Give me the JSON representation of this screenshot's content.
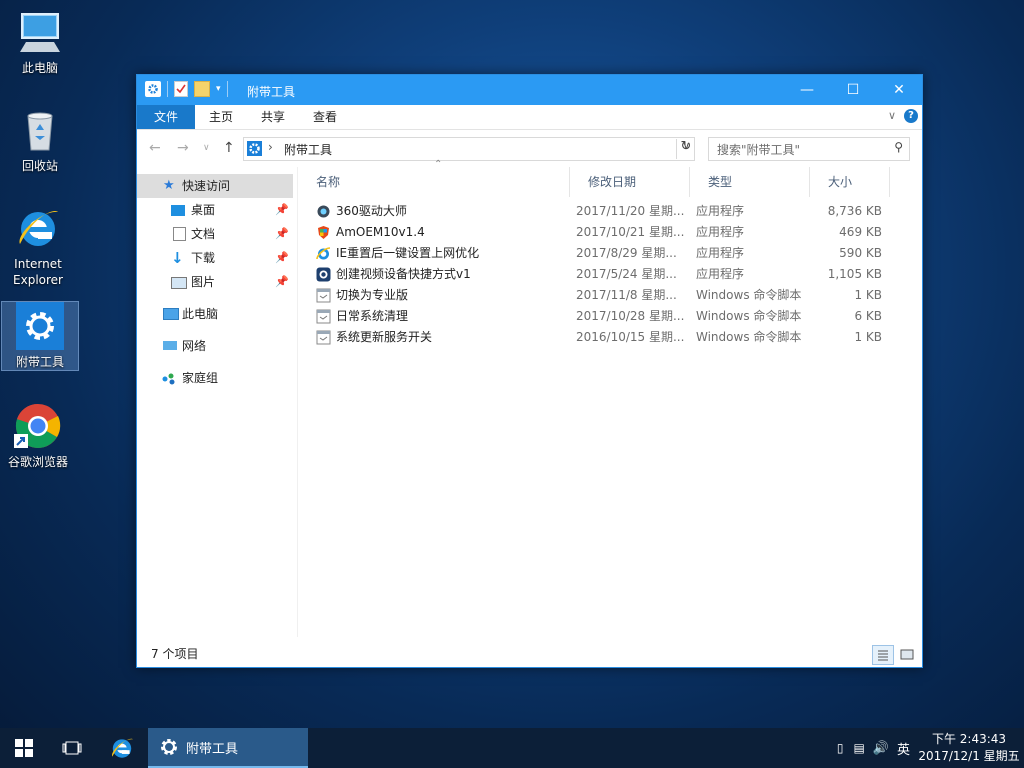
{
  "desktop": {
    "icons": [
      {
        "label": "此电脑",
        "icon": "computer-icon"
      },
      {
        "label": "回收站",
        "icon": "recycle-bin-icon"
      },
      {
        "label": "Internet Explorer",
        "icon": "ie-icon"
      },
      {
        "label": "附带工具",
        "icon": "gear-icon"
      },
      {
        "label": "谷歌浏览器",
        "icon": "chrome-icon"
      }
    ]
  },
  "window": {
    "title": "附带工具",
    "ribbon_tabs": [
      "文件",
      "主页",
      "共享",
      "查看"
    ],
    "breadcrumb": "附带工具",
    "search_placeholder": "搜索\"附带工具\"",
    "sidebar": [
      {
        "label": "快速访问",
        "icon": "star-icon",
        "pinned": false,
        "active": true
      },
      {
        "label": "桌面",
        "icon": "desktop-icon",
        "pinned": true
      },
      {
        "label": "文档",
        "icon": "document-icon",
        "pinned": true
      },
      {
        "label": "下载",
        "icon": "download-icon",
        "pinned": true
      },
      {
        "label": "图片",
        "icon": "pictures-icon",
        "pinned": true
      },
      {
        "label": "此电脑",
        "icon": "computer-icon",
        "pinned": false
      },
      {
        "label": "网络",
        "icon": "network-icon",
        "pinned": false
      },
      {
        "label": "家庭组",
        "icon": "homegroup-icon",
        "pinned": false
      }
    ],
    "columns": [
      "名称",
      "修改日期",
      "类型",
      "大小"
    ],
    "files": [
      {
        "name": "360驱动大师",
        "date": "2017/11/20 星期...",
        "type": "应用程序",
        "size": "8,736 KB",
        "icon": "driver-app-icon"
      },
      {
        "name": "AmOEM10v1.4",
        "date": "2017/10/21 星期...",
        "type": "应用程序",
        "size": "469 KB",
        "icon": "shield-app-icon"
      },
      {
        "name": "IE重置后一键设置上网优化",
        "date": "2017/8/29 星期...",
        "type": "应用程序",
        "size": "590 KB",
        "icon": "ie-app-icon"
      },
      {
        "name": "创建视频设备快捷方式v1",
        "date": "2017/5/24 星期...",
        "type": "应用程序",
        "size": "1,105 KB",
        "icon": "camera-app-icon"
      },
      {
        "name": "切换为专业版",
        "date": "2017/11/8 星期...",
        "type": "Windows 命令脚本",
        "size": "1 KB",
        "icon": "script-icon"
      },
      {
        "name": "日常系统清理",
        "date": "2017/10/28 星期...",
        "type": "Windows 命令脚本",
        "size": "6 KB",
        "icon": "script-icon"
      },
      {
        "name": "系统更新服务开关",
        "date": "2016/10/15 星期...",
        "type": "Windows 命令脚本",
        "size": "1 KB",
        "icon": "script-icon"
      }
    ],
    "status": "7 个项目"
  },
  "taskbar": {
    "active_window": "附带工具",
    "ime": "英",
    "time": "下午 2:43:43",
    "date": "2017/12/1 星期五"
  },
  "colors": {
    "titlebar": "#2b9af3",
    "file_tab": "#1979ca",
    "taskbar": "#0c1f38"
  }
}
